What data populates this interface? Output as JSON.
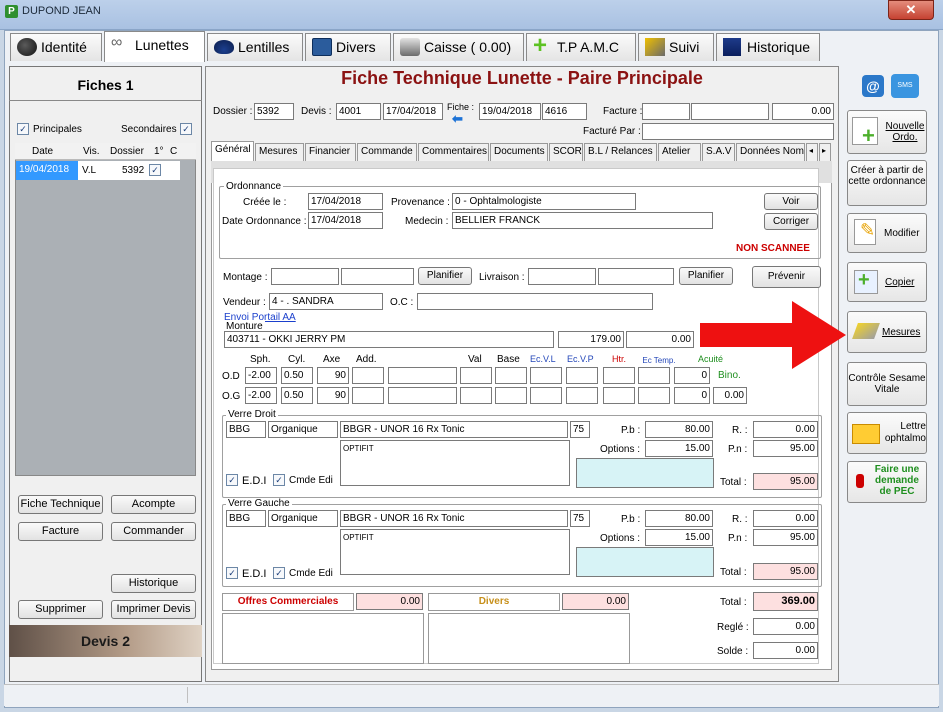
{
  "window": {
    "title": "DUPOND JEAN",
    "app_icon": "P",
    "close": "✕"
  },
  "main_tabs": [
    {
      "label": "Identité",
      "icon": "identity-icon"
    },
    {
      "label": "Lunettes",
      "icon": "glasses-icon"
    },
    {
      "label": "Lentilles",
      "icon": "lens-icon"
    },
    {
      "label": "Divers",
      "icon": "calculator-icon"
    },
    {
      "label": "Caisse ( 0.00)",
      "icon": "cash-register-icon"
    },
    {
      "label": "T.P A.M.C",
      "icon": "plus-icon"
    },
    {
      "label": "Suivi",
      "icon": "follow-icon"
    },
    {
      "label": "Historique",
      "icon": "history-icon"
    }
  ],
  "left": {
    "title": "Fiches 1",
    "principales": "Principales",
    "secondaires": "Secondaires",
    "columns": [
      "Date",
      "Vis.",
      "Dossier",
      "1°",
      "C"
    ],
    "row": {
      "date": "19/04/2018",
      "vis": "V.L",
      "dossier": "5392"
    },
    "buttons": {
      "fiche_technique": "Fiche Technique",
      "acompte": "Acompte",
      "facture": "Facture",
      "commander": "Commander",
      "historique": "Historique",
      "supprimer": "Supprimer",
      "imprimer_devis": "Imprimer Devis"
    },
    "devis": "Devis 2"
  },
  "header": {
    "title": "Fiche Technique Lunette - Paire Principale",
    "dossier_label": "Dossier :",
    "dossier": "5392",
    "devis_label": "Devis :",
    "devis": "4001",
    "devis_date": "17/04/2018",
    "fiche_label": "Fiche :",
    "fiche_date": "19/04/2018",
    "fiche_num": "4616",
    "facture_label": "Facture :",
    "facture_amount": "0.00",
    "facture_par_label": "Facturé Par :"
  },
  "sub_tabs": [
    "Général",
    "Mesures",
    "Financier",
    "Commande",
    "Commentaires",
    "Documents",
    "SCOR",
    "B.L / Relances",
    "Atelier",
    "S.A.V",
    "Données Nom"
  ],
  "ordonnance": {
    "title": "Ordonnance",
    "creee_label": "Créée le :",
    "creee": "17/04/2018",
    "provenance_label": "Provenance :",
    "provenance": "0 - Ophtalmologiste",
    "date_ord_label": "Date Ordonnance :",
    "date_ord": "17/04/2018",
    "medecin_label": "Medecin :",
    "medecin": "BELLIER FRANCK",
    "voir": "Voir",
    "corriger": "Corriger",
    "status": "NON SCANNEE"
  },
  "montage": {
    "montage_label": "Montage :",
    "planifier": "Planifier",
    "livraison_label": "Livraison :",
    "prevenir": "Prévenir",
    "vendeur_label": "Vendeur :",
    "vendeur": "4 - . SANDRA",
    "oc_label": "O.C :",
    "portail": "Envoi Portail AA"
  },
  "monture": {
    "title": "Monture",
    "name": "403711 - OKKI JERRY PM",
    "price": "179.00",
    "extra": "0.00"
  },
  "prescription": {
    "headers": [
      "Sph.",
      "Cyl.",
      "Axe",
      "Add.",
      "Val",
      "Base",
      "Ec.V.L",
      "Ec.V.P",
      "Htr.",
      "Ec Temp.",
      "Acuité"
    ],
    "od_label": "O.D",
    "og_label": "O.G",
    "bino": "Bino.",
    "od": {
      "sph": "-2.00",
      "cyl": "0.50",
      "axe": "90",
      "ec": "0"
    },
    "og": {
      "sph": "-2.00",
      "cyl": "0.50",
      "axe": "90",
      "ec": "0",
      "acuite": "0.00"
    }
  },
  "verre_droit": {
    "title": "Verre Droit",
    "brand": "BBG",
    "type": "Organique",
    "name": "BBGR - UNOR 16 Rx Tonic",
    "diam": "75",
    "comment": "OPTIFIT",
    "pb_label": "P.b :",
    "pb": "80.00",
    "options_label": "Options :",
    "options": "15.00",
    "r_label": "R. :",
    "r": "0.00",
    "pn_label": "P.n :",
    "pn": "95.00",
    "total_label": "Total :",
    "total": "95.00",
    "edi": "E.D.I",
    "cmde_edi": "Cmde Edi"
  },
  "verre_gauche": {
    "title": "Verre Gauche",
    "brand": "BBG",
    "type": "Organique",
    "name": "BBGR - UNOR 16 Rx Tonic",
    "diam": "75",
    "comment": "OPTIFIT",
    "pb_label": "P.b :",
    "pb": "80.00",
    "options_label": "Options :",
    "options": "15.00",
    "r_label": "R. :",
    "r": "0.00",
    "pn_label": "P.n :",
    "pn": "95.00",
    "total_label": "Total :",
    "total": "95.00",
    "edi": "E.D.I",
    "cmde_edi": "Cmde Edi"
  },
  "totals": {
    "offres_label": "Offres Commerciales",
    "offres": "0.00",
    "divers_label": "Divers",
    "divers": "0.00",
    "total_label": "Total :",
    "total": "369.00",
    "regle_label": "Reglé :",
    "regle": "0.00",
    "solde_label": "Solde :",
    "solde": "0.00"
  },
  "right": {
    "nouvelle_ordo": "Nouvelle Ordo.",
    "creer_partir": "Créer à partir de cette ordonnance",
    "modifier": "Modifier",
    "copier": "Copier",
    "mesures": "Mesures",
    "controle": "Contrôle Sesame Vitale",
    "lettre": "Lettre ophtalmo",
    "pec": "Faire une demande de PEC"
  },
  "colors": {
    "accent_red": "#cc0000",
    "title_red": "#8b1212",
    "select_blue": "#3399ff",
    "pink": "#fde0e0",
    "cyan": "#d7f3f6"
  }
}
